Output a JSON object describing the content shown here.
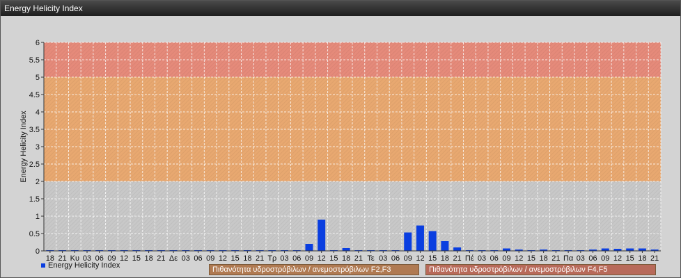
{
  "window": {
    "title": "Energy Helicity Index"
  },
  "colors": {
    "bar": "#0a3ee0",
    "band_high": "#e58a7a",
    "band_mid": "#e8a870",
    "band_low": "#c8c8c8",
    "grid": "#ffffff"
  },
  "legend_boxes": [
    {
      "label": "Πιθανότητα υδροστρόβιλων / ανεμοστρόβιλων F2,F3",
      "color": "#b07a52"
    },
    {
      "label": "Πιθανότητα υδροστρόβιλων / ανεμοστρόβιλων F4,F5",
      "color": "#b86a5a"
    }
  ],
  "chart_data": {
    "type": "bar",
    "ylabel": "Energy Helicity Index",
    "ylim": [
      0,
      6
    ],
    "yticks": [
      "0",
      "0.5",
      "1",
      "1.5",
      "2",
      "2.5",
      "3",
      "3.5",
      "4",
      "4.5",
      "5",
      "5.5",
      "6"
    ],
    "bands": [
      {
        "from": 0,
        "to": 2,
        "color": "#c8c8c8"
      },
      {
        "from": 2,
        "to": 5,
        "color": "#e8a870"
      },
      {
        "from": 5,
        "to": 6,
        "color": "#e58a7a"
      }
    ],
    "grid": true,
    "legend_position": "bottom-left",
    "categories": [
      "18",
      "21",
      "Κυ",
      "03",
      "06",
      "09",
      "12",
      "15",
      "18",
      "21",
      "Δε",
      "03",
      "06",
      "09",
      "12",
      "15",
      "18",
      "21",
      "Τρ",
      "03",
      "06",
      "09",
      "12",
      "15",
      "18",
      "21",
      "Τε",
      "03",
      "06",
      "09",
      "12",
      "15",
      "18",
      "21",
      "Πέ",
      "03",
      "06",
      "09",
      "12",
      "15",
      "18",
      "21",
      "Πα",
      "03",
      "06",
      "09",
      "12",
      "15",
      "18",
      "21"
    ],
    "series": [
      {
        "name": "Energy Helicity Index",
        "values": [
          0.02,
          0.02,
          0.02,
          0.02,
          0.02,
          0.02,
          0.02,
          0.02,
          0.02,
          0.02,
          0.02,
          0.02,
          0.02,
          0.02,
          0.02,
          0.02,
          0.02,
          0.02,
          0.02,
          0.02,
          0.02,
          0.2,
          0.9,
          0.02,
          0.08,
          0.02,
          0.02,
          0.02,
          0.02,
          0.53,
          0.73,
          0.57,
          0.28,
          0.1,
          0.02,
          0.02,
          0.02,
          0.07,
          0.04,
          0.02,
          0.04,
          0.02,
          0.02,
          0.02,
          0.04,
          0.07,
          0.06,
          0.07,
          0.07,
          0.04
        ]
      }
    ]
  }
}
